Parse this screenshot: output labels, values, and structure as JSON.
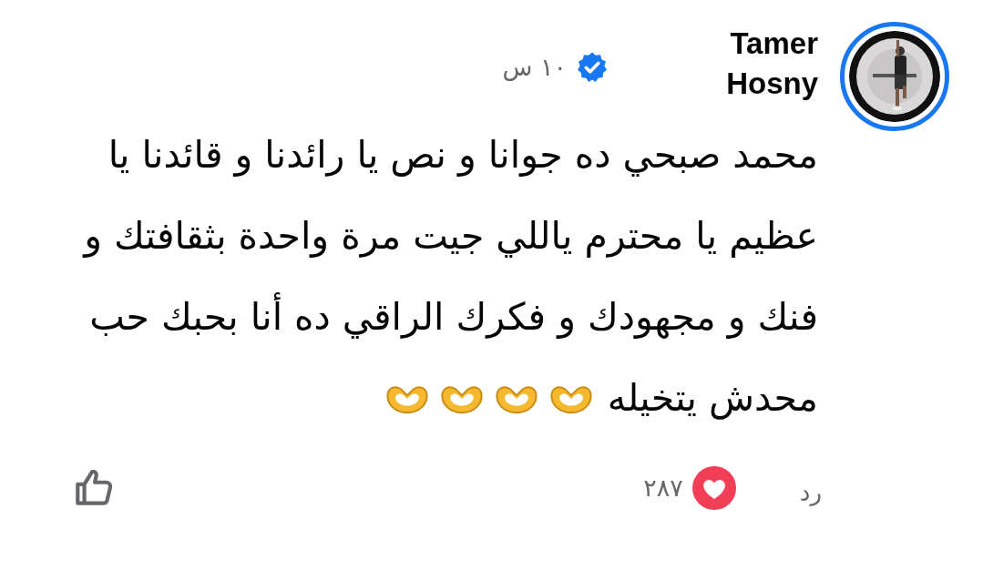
{
  "comment": {
    "author": "Tamer Hosny",
    "verified": true,
    "time": "١٠ س",
    "text_lines": [
      "محمد صبحي ده جوانا و نص يا رائدنا و قائدنا يا",
      "عظيم يا محترم ياللي جيت مرة واحدة بثقافتك و",
      "فنك و مجهودك و فكرك الراقي ده أنا بحبك حب",
      "محدش يتخيله"
    ],
    "emojis": [
      {
        "kind": "heart_hands"
      },
      {
        "kind": "heart_hands"
      },
      {
        "kind": "heart_hands"
      },
      {
        "kind": "heart_hands"
      }
    ],
    "reply": "رد",
    "reactions": {
      "count": "٢٨٧"
    },
    "liked": false
  }
}
